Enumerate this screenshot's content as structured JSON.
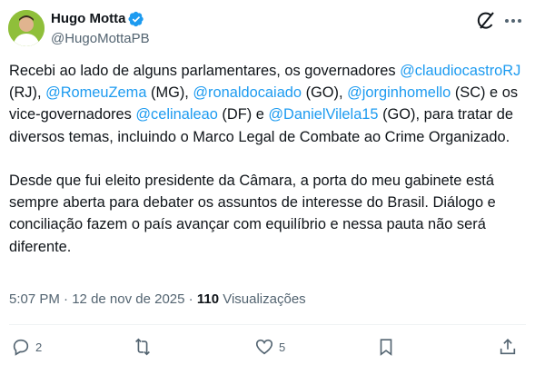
{
  "author": {
    "display_name": "Hugo Motta",
    "handle": "@HugoMottaPB",
    "verified_icon": "verified-badge-icon",
    "accent_color": "#1d9bf0"
  },
  "header_icons": [
    "grok-icon",
    "more-icon"
  ],
  "tweet": {
    "paragraph1": [
      {
        "text": "Recebi ao lado de alguns parlamentares, os governadores ",
        "type": "text"
      },
      {
        "text": "@claudiocastroRJ",
        "type": "mention"
      },
      {
        "text": " (RJ), ",
        "type": "text"
      },
      {
        "text": "@RomeuZema",
        "type": "mention"
      },
      {
        "text": " (MG), ",
        "type": "text"
      },
      {
        "text": "@ronaldocaiado",
        "type": "mention"
      },
      {
        "text": " (GO), ",
        "type": "text"
      },
      {
        "text": "@jorginhomello",
        "type": "mention"
      },
      {
        "text": " (SC) e os vice-governadores ",
        "type": "text"
      },
      {
        "text": "@celinaleao",
        "type": "mention"
      },
      {
        "text": " (DF) e ",
        "type": "text"
      },
      {
        "text": "@DanielVilela15",
        "type": "mention"
      },
      {
        "text": " (GO), para tratar de diversos temas, incluindo o Marco Legal de Combate ao Crime Organizado.",
        "type": "text"
      }
    ],
    "paragraph2": "Desde que fui eleito presidente da Câmara, a porta do meu gabinete está sempre aberta para debater os assuntos de interesse do Brasil. Diálogo e conciliação fazem o país avançar com equilíbrio e nessa pauta não será diferente."
  },
  "meta": {
    "time": "5:07 PM",
    "separator": " · ",
    "date": "12 de nov de 2025",
    "views_count": "110",
    "views_label": "Visualizações"
  },
  "actions": {
    "reply_count": "2",
    "repost_count": "",
    "like_count": "5"
  }
}
